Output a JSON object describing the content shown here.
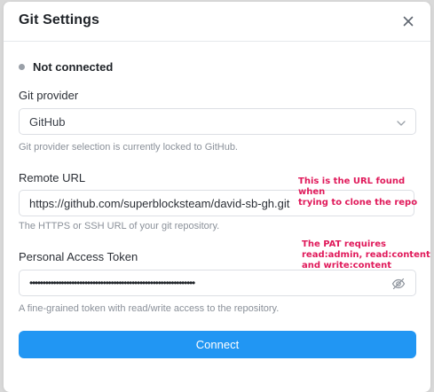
{
  "dialog": {
    "title": "Git Settings",
    "close_icon": "close-icon"
  },
  "status": {
    "text": "Not connected",
    "dot_color": "#9aa0a8"
  },
  "provider": {
    "label": "Git provider",
    "selected": "GitHub",
    "help": "Git provider selection is currently locked to GitHub."
  },
  "remote_url": {
    "label": "Remote URL",
    "value": "https://github.com/superblocksteam/david-sb-gh.git",
    "help": "The HTTPS or SSH URL of your git repository."
  },
  "token": {
    "label": "Personal Access Token",
    "masked_value": "•••••••••••••••••••••••••••••••••••••••••••••••••••••••••••••••",
    "help": "A fine-grained token with read/write access to the repository.",
    "toggle_icon": "eye-off-icon"
  },
  "annotations": {
    "url_note": "This is the URL found when\ntrying to clone the repo",
    "pat_note": "The PAT requires\nread:admin, read:content\nand write:content",
    "color": "#e0195a"
  },
  "actions": {
    "connect_label": "Connect",
    "accent": "#2196f3"
  }
}
